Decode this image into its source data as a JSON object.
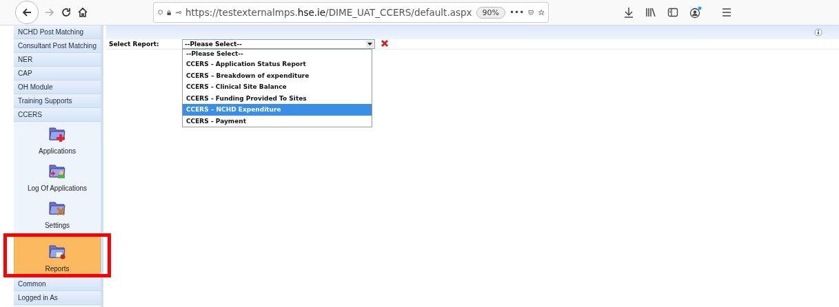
{
  "browser": {
    "url": "https://testexternalmps.**hse.ie**/DIME_UAT_CCERS/default.aspx",
    "zoom": "90%",
    "menu_dots": "•••"
  },
  "sidebar": {
    "items": [
      {
        "label": "NCHD Post Matching"
      },
      {
        "label": "Consultant Post Matching"
      },
      {
        "label": "NER"
      },
      {
        "label": "CAP"
      },
      {
        "label": "OH Module"
      },
      {
        "label": "Training Supports"
      },
      {
        "label": "CCERS",
        "children": [
          {
            "label": "Applications",
            "kind": "applications",
            "selected": false
          },
          {
            "label": "Log Of Applications",
            "kind": "log",
            "selected": false
          },
          {
            "label": "Settings",
            "kind": "settings",
            "selected": false
          },
          {
            "label": "Reports",
            "kind": "reports",
            "selected": true,
            "highlighted": true
          }
        ]
      },
      {
        "label": "Common"
      },
      {
        "label": "Logged in As"
      }
    ]
  },
  "report_form": {
    "label": "Select Report:",
    "value": "--Please Select--",
    "open": true,
    "options": [
      {
        "label": "--Please Select--",
        "highlighted": false
      },
      {
        "label": "CCERS - Application Status Report",
        "highlighted": false
      },
      {
        "label": "CCERS – Breakdown of expenditure",
        "highlighted": false
      },
      {
        "label": "CCERS - Clinical Site Balance",
        "highlighted": false
      },
      {
        "label": "CCERS - Funding Provided To Sites",
        "highlighted": false
      },
      {
        "label": "CCERS – NCHD Expenditure",
        "highlighted": true
      },
      {
        "label": "CCERS - Payment",
        "highlighted": false
      }
    ]
  }
}
